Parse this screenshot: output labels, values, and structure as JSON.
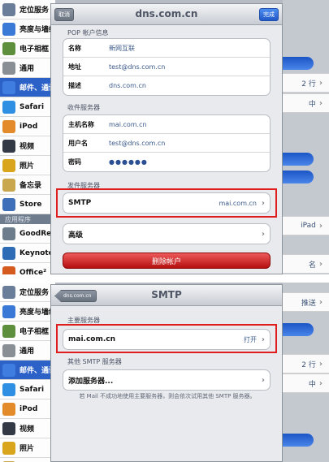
{
  "bg_rows_1": [
    {
      "label": "定位服务",
      "color": "#6a7d99"
    },
    {
      "label": "亮度与墙纸",
      "color": "#3b79d6"
    },
    {
      "label": "电子相框",
      "color": "#5e8f3c"
    },
    {
      "label": "通用",
      "color": "#8a8f96"
    },
    {
      "label": "邮件、通讯",
      "color": "#3f7ee0",
      "selected": true
    },
    {
      "label": "Safari",
      "color": "#2f8fe3"
    },
    {
      "label": "iPod",
      "color": "#e38a2a"
    },
    {
      "label": "视频",
      "color": "#333a45"
    },
    {
      "label": "照片",
      "color": "#d9a51c"
    },
    {
      "label": "备忘录",
      "color": "#c9a84d"
    },
    {
      "label": "Store",
      "color": "#3f6fb8"
    },
    {
      "label": "应用程序",
      "section": true
    },
    {
      "label": "GoodRe",
      "color": "#6d7d8c"
    },
    {
      "label": "Keynote",
      "color": "#2e6cb5"
    },
    {
      "label": "Office²",
      "color": "#d45a1d"
    }
  ],
  "bg_rows_2": [
    {
      "label": "定位服务",
      "color": "#6a7d99"
    },
    {
      "label": "亮度与墙纸",
      "color": "#3b79d6"
    },
    {
      "label": "电子相框",
      "color": "#5e8f3c"
    },
    {
      "label": "通用",
      "color": "#8a8f96"
    },
    {
      "label": "邮件、通讯",
      "color": "#3f7ee0",
      "selected": true
    },
    {
      "label": "Safari",
      "color": "#2f8fe3"
    },
    {
      "label": "iPod",
      "color": "#e38a2a"
    },
    {
      "label": "视频",
      "color": "#333a45"
    },
    {
      "label": "照片",
      "color": "#d9a51c"
    },
    {
      "label": "备忘录",
      "color": "#c9a84d"
    }
  ],
  "bg_right_1": [
    "2 行",
    "中",
    "iPad",
    "名"
  ],
  "bg_right_2": [
    "推送",
    "2 行",
    "中"
  ],
  "screen1": {
    "nav": {
      "title": "dns.com.cn",
      "cancel": "取消",
      "done": "完成"
    },
    "pop_header": "POP 帐户信息",
    "pop_rows": [
      {
        "key": "名称",
        "value": "新网互联"
      },
      {
        "key": "地址",
        "value": "test@dns.com.cn"
      },
      {
        "key": "描述",
        "value": "dns.com.cn"
      }
    ],
    "incoming_header": "收件服务器",
    "incoming_rows": [
      {
        "key": "主机名称",
        "value": "mai.com.cn"
      },
      {
        "key": "用户名",
        "value": "test@dns.com.cn"
      },
      {
        "key": "密码",
        "value": "●●●●●●"
      }
    ],
    "outgoing_header": "发件服务器",
    "smtp_label": "SMTP",
    "smtp_value": "mai.com.cn",
    "advanced_label": "高级",
    "delete_label": "删除帐户"
  },
  "screen2": {
    "nav": {
      "title": "SMTP",
      "back": "dns.com.cn"
    },
    "primary_header": "主要服务器",
    "primary_server": "mai.com.cn",
    "primary_status": "打开",
    "other_header": "其他 SMTP 服务器",
    "add_server": "添加服务器...",
    "note": "若 Mail 不成功地使用主要服务器，则会依次试用其他 SMTP 服务器。"
  },
  "colors": {
    "highlight": "#e01d1d",
    "selection": "#2c62c8",
    "delete_red": "#c81818"
  }
}
